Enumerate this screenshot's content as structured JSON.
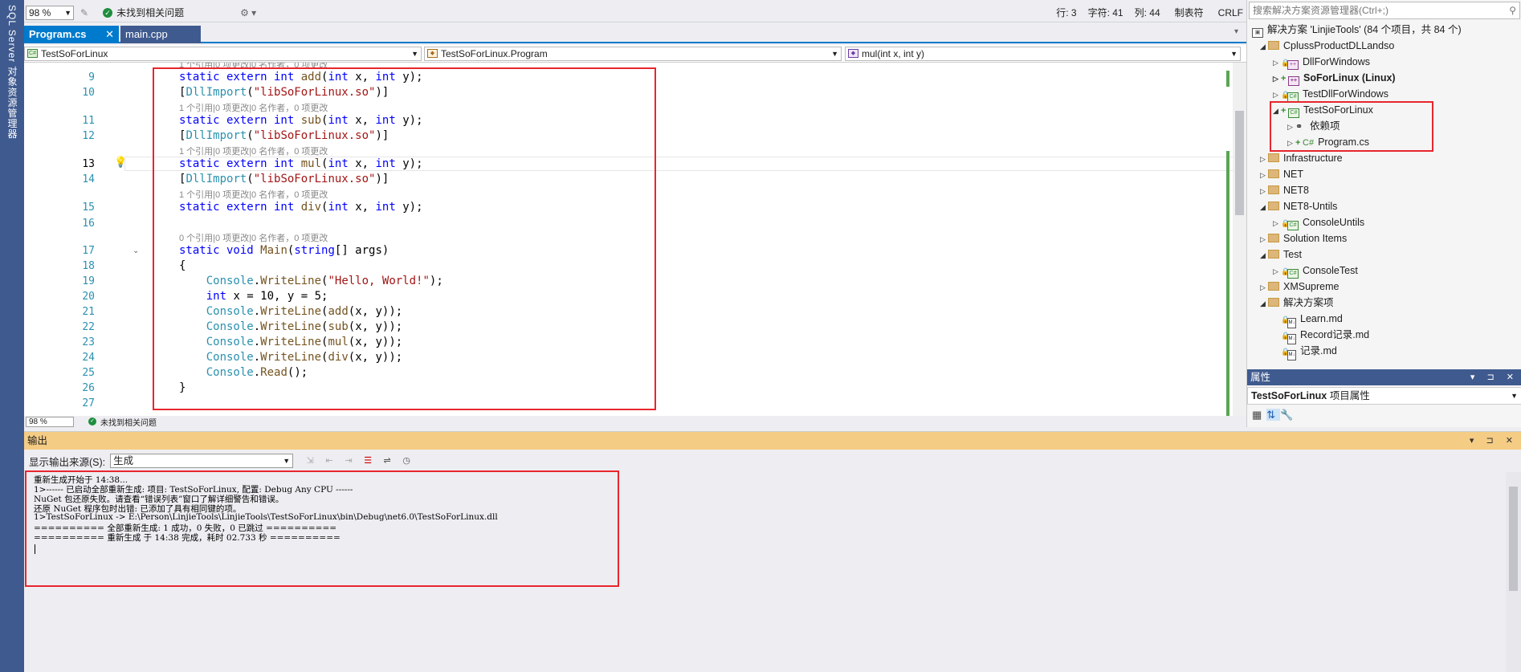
{
  "left_strip": {
    "text": "SQL Server 对象资源管理器"
  },
  "editor": {
    "top_status": {
      "zoom": "98 %",
      "issues": "未找到相关问题",
      "line": "行: 3",
      "char": "字符: 41",
      "col": "列: 44",
      "tabs": "制表符",
      "eol": "CRLF"
    },
    "tabs": [
      {
        "label": "Program.cs",
        "active": true
      },
      {
        "label": "main.cpp",
        "active": false
      }
    ],
    "nav": {
      "project": "TestSoForLinux",
      "class": "TestSoForLinux.Program",
      "member": "mul(int x, int y)"
    },
    "code_lines": [
      {
        "num": "9",
        "text": "static extern int add(int x, int y);"
      },
      {
        "num": "10",
        "text": "[DllImport(\"libSoForLinux.so\")]"
      },
      {
        "num": "11",
        "text": "static extern int sub(int x, int y);"
      },
      {
        "num": "12",
        "text": "[DllImport(\"libSoForLinux.so\")]"
      },
      {
        "num": "13",
        "text": "static extern int mul(int x, int y);"
      },
      {
        "num": "14",
        "text": "[DllImport(\"libSoForLinux.so\")]"
      },
      {
        "num": "15",
        "text": "static extern int div(int x, int y);"
      },
      {
        "num": "16",
        "text": ""
      },
      {
        "num": "17",
        "text": "static void Main(string[] args)"
      },
      {
        "num": "18",
        "text": "{"
      },
      {
        "num": "19",
        "text": "    Console.WriteLine(\"Hello, World!\");"
      },
      {
        "num": "20",
        "text": "    int x = 10, y = 5;"
      },
      {
        "num": "21",
        "text": "    Console.WriteLine(add(x, y));"
      },
      {
        "num": "22",
        "text": "    Console.WriteLine(sub(x, y));"
      },
      {
        "num": "23",
        "text": "    Console.WriteLine(mul(x, y));"
      },
      {
        "num": "24",
        "text": "    Console.WriteLine(div(x, y));"
      },
      {
        "num": "25",
        "text": "    Console.Read();"
      },
      {
        "num": "26",
        "text": "}"
      },
      {
        "num": "27",
        "text": ""
      }
    ],
    "codelens": "1 个引用|0 项更改|0 名作者，0 项更改",
    "codelens_main": "0 个引用|0 项更改|0 名作者，0 项更改",
    "bottom_status": {
      "zoom": "98 %",
      "issues": "未找到相关问题"
    }
  },
  "solution_explorer": {
    "search_placeholder": "搜索解决方案资源管理器(Ctrl+;)",
    "nodes": [
      {
        "label": "解决方案 'LinjieTools' (84 个项目，共 84 个)"
      },
      {
        "label": "CplussProductDLLandso"
      },
      {
        "label": "DllForWindows"
      },
      {
        "label": "SoForLinux (Linux)"
      },
      {
        "label": "TestDllForWindows"
      },
      {
        "label": "TestSoForLinux"
      },
      {
        "label": "依赖项"
      },
      {
        "label": "Program.cs"
      },
      {
        "label": "Infrastructure"
      },
      {
        "label": "NET"
      },
      {
        "label": "NET8"
      },
      {
        "label": "NET8-Untils"
      },
      {
        "label": "ConsoleUntils"
      },
      {
        "label": "Solution Items"
      },
      {
        "label": "Test"
      },
      {
        "label": "ConsoleTest"
      },
      {
        "label": "XMSupreme"
      },
      {
        "label": "解决方案项"
      },
      {
        "label": "Learn.md"
      },
      {
        "label": "Record记录.md"
      },
      {
        "label": "记录.md"
      }
    ]
  },
  "properties": {
    "title": "属性",
    "subject": "TestSoForLinux",
    "subject_suffix": "项目属性"
  },
  "output": {
    "title": "输出",
    "source_label": "显示输出来源(S):",
    "source_value": "生成",
    "lines": [
      "重新生成开始于 14:38...",
      "1>------ 已启动全部重新生成: 项目: TestSoForLinux, 配置: Debug Any CPU ------",
      "NuGet 包还原失败。请查看“错误列表”窗口了解详细警告和错误。",
      "还原 NuGet 程序包时出错: 已添加了具有相同键的项。",
      "1>TestSoForLinux -> E:\\Person\\LinjieTools\\LinjieTools\\TestSoForLinux\\bin\\Debug\\net6.0\\TestSoForLinux.dll",
      "========== 全部重新生成: 1 成功，0 失败，0 已跳过 ==========",
      "========== 重新生成 于 14:38 完成，耗时 02.733 秒 =========="
    ]
  },
  "colors": {
    "accent": "#007acc",
    "panel_header": "#3f5a8f",
    "output_header": "#f5cc84",
    "highlight_box": "#e8262d"
  }
}
